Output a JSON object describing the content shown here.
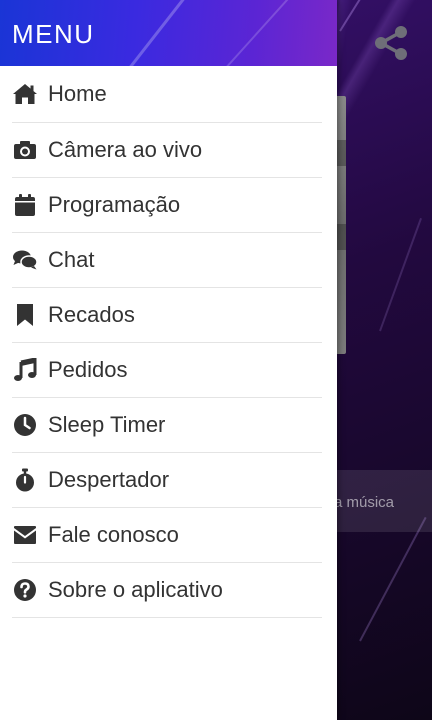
{
  "drawer": {
    "title": "MENU",
    "header_gradient": [
      "#1a35d6",
      "#7a28c8"
    ],
    "items": [
      {
        "label": "Home",
        "icon": "home-icon"
      },
      {
        "label": "Câmera ao vivo",
        "icon": "camera-icon"
      },
      {
        "label": "Programação",
        "icon": "calendar-icon"
      },
      {
        "label": "Chat",
        "icon": "chat-icon"
      },
      {
        "label": "Recados",
        "icon": "bookmark-icon"
      },
      {
        "label": "Pedidos",
        "icon": "music-icon"
      },
      {
        "label": "Sleep Timer",
        "icon": "clock-icon"
      },
      {
        "label": "Despertador",
        "icon": "stopwatch-icon"
      },
      {
        "label": "Fale conosco",
        "icon": "envelope-icon"
      },
      {
        "label": "Sobre o aplicativo",
        "icon": "question-icon"
      }
    ]
  },
  "background": {
    "player_text": "a música",
    "share_icon": "share-icon",
    "accent": "#3a1276"
  }
}
